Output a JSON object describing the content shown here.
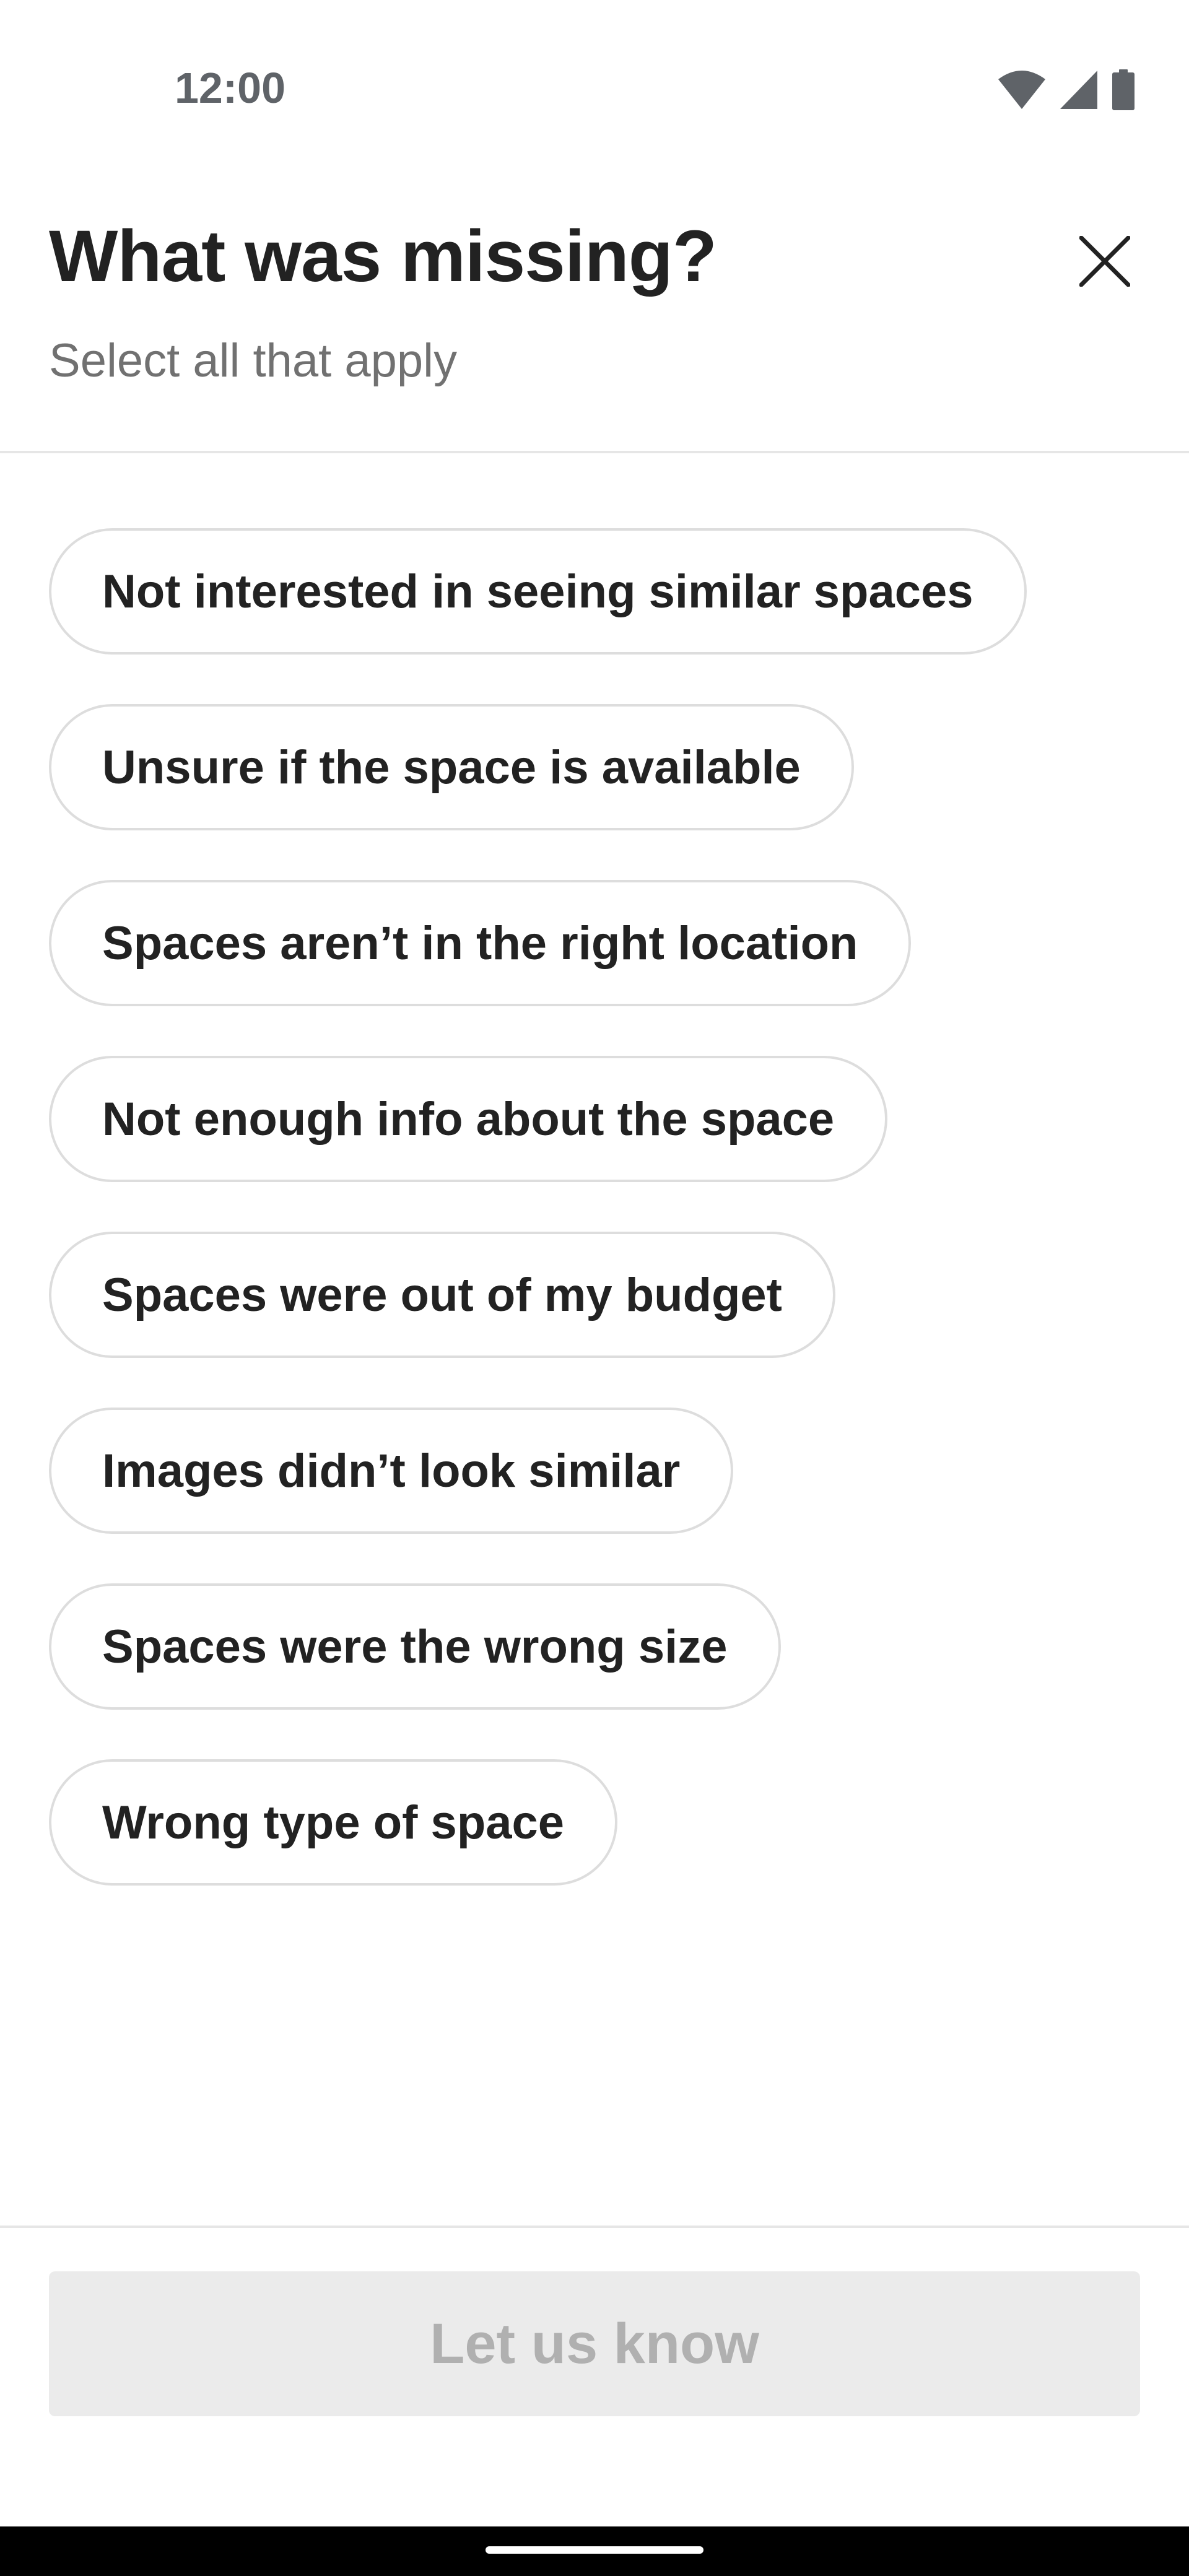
{
  "status_bar": {
    "time": "12:00",
    "icons": [
      "wifi-icon",
      "signal-icon",
      "battery-icon"
    ]
  },
  "header": {
    "title": "What was missing?",
    "subtitle": "Select all that apply",
    "close_icon": "close-icon"
  },
  "options": [
    {
      "label": "Not interested in seeing similar spaces"
    },
    {
      "label": "Unsure if the space is available"
    },
    {
      "label": "Spaces aren’t in the right location"
    },
    {
      "label": "Not enough info about the space"
    },
    {
      "label": "Spaces were out of my budget"
    },
    {
      "label": "Images didn’t look similar"
    },
    {
      "label": "Spaces were the wrong size"
    },
    {
      "label": "Wrong type of space"
    }
  ],
  "footer": {
    "submit_label": "Let us know",
    "submit_state": "disabled"
  },
  "colors": {
    "title_text": "#222222",
    "subtitle_text": "#717171",
    "chip_border": "#dddddd",
    "button_disabled_bg": "#ebebeb",
    "button_disabled_text": "#b0b0b0",
    "divider": "#e6e6e6"
  }
}
